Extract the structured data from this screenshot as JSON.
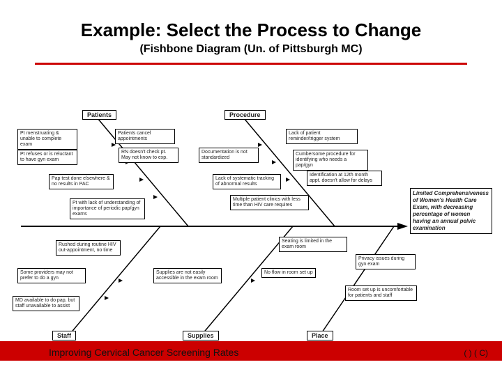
{
  "header": {
    "title": "Example:  Select the Process to Change",
    "subtitle": "(Fishbone Diagram  (Un. of Pittsburgh MC)"
  },
  "diagram": {
    "categories": {
      "patients": "Patients",
      "procedure": "Procedure",
      "staff": "Staff",
      "supplies": "Supplies",
      "place": "Place"
    },
    "effect": "Limited Comprehensiveness of Women's Health Care Exam, with decreasing percentage of women having an annual pelvic examination",
    "causes": {
      "patients": [
        "Pt menstruating & unable to complete exam",
        "Pt refuses or is reluctant to have gyn exam",
        "Patients cancel appointments",
        "RN doesn't check pt. May not know to exp.",
        "Pap test done elsewhere & no results in PAC",
        "Pt with lack of understanding of importance of periodic pap/gyn exams"
      ],
      "procedure": [
        "Lack of patient reminder/trigger system",
        "Documentation is not standardized",
        "Cumbersome procedure for identifying who needs a pap/gyn",
        "Lack of systematic tracking of abnormal results",
        "Identification at 12th month appt. doesn't allow for delays",
        "Multiple patient clinics with less time than HIV care requires"
      ],
      "staff": [
        "Rushed during routine HIV out-appointment, no time",
        "Some providers may not prefer to do a gyn",
        "MD available to do pap, but staff unavailable to assist"
      ],
      "supplies": [
        "Supplies are not easily accessible in the exam room"
      ],
      "place": [
        "Seating is limited in the exam room",
        "No flow in room set up",
        "Privacy issues during gyn exam",
        "Room set up is uncomfortable for patients and staff"
      ]
    }
  },
  "footer": {
    "label": "Improving Cervical Cancer Screening Rates",
    "right": "(     )        (     C)"
  }
}
